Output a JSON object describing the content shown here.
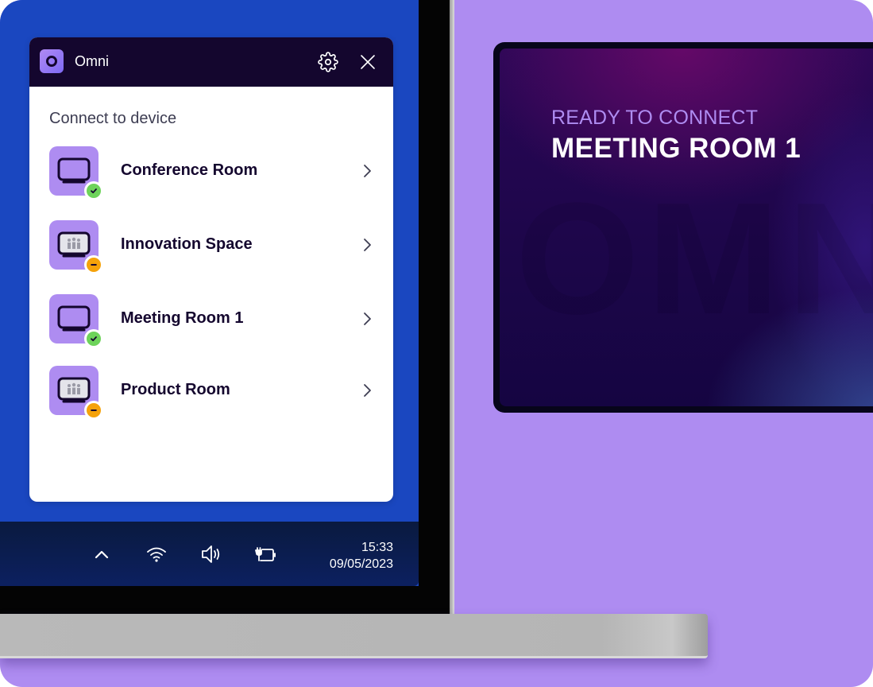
{
  "app": {
    "title": "Omni",
    "logo_icon": "omni-logo-icon",
    "settings_icon": "gear-icon",
    "close_icon": "close-icon"
  },
  "panel": {
    "section_title": "Connect to device",
    "devices": [
      {
        "name": "Conference Room",
        "icon": "display-icon",
        "status": "available",
        "status_icon": "check-icon"
      },
      {
        "name": "Innovation Space",
        "icon": "display-in-use-icon",
        "status": "busy",
        "status_icon": "minus-icon"
      },
      {
        "name": "Meeting Room 1",
        "icon": "display-icon",
        "status": "available",
        "status_icon": "check-icon"
      },
      {
        "name": "Product Room",
        "icon": "display-in-use-icon",
        "status": "busy",
        "status_icon": "minus-icon"
      }
    ]
  },
  "taskbar": {
    "icons": [
      "chevron-up-icon",
      "wifi-icon",
      "volume-icon",
      "battery-charging-icon"
    ],
    "time": "15:33",
    "date": "09/05/2023"
  },
  "display": {
    "subtitle": "READY TO CONNECT",
    "title": "MEETING ROOM 1",
    "watermark": "OMNI"
  },
  "colors": {
    "brand_purple": "#ae8cf1",
    "header_dark": "#14062e",
    "desktop_blue": "#1a47c0",
    "status_available": "#6dd35a",
    "status_busy": "#f5a20a"
  }
}
